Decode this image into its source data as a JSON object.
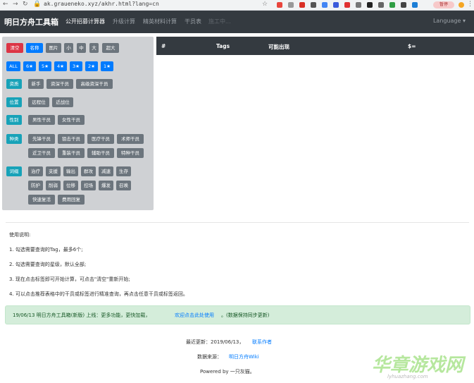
{
  "browser": {
    "url": "ak.graueneko.xyz/akhr.html?lang=cn",
    "profile_label": "暂停"
  },
  "navbar": {
    "brand": "明日方舟工具箱",
    "links": [
      "公开招募计算器",
      "升级计算",
      "精英材料计算",
      "干员表",
      "施工中..."
    ],
    "language": "Language ▾"
  },
  "filters": {
    "actions": [
      "清空",
      "名称",
      "图片",
      "小",
      "中",
      "大",
      "超大"
    ],
    "stars": [
      "ALL",
      "6★",
      "5★",
      "4★",
      "3★",
      "2★",
      "1★"
    ],
    "qualification": {
      "label": "资质",
      "tags": [
        "新手",
        "资深干员",
        "高级资深干员"
      ]
    },
    "position": {
      "label": "位置",
      "tags": [
        "远程位",
        "近战位"
      ]
    },
    "gender": {
      "label": "性别",
      "tags": [
        "男性干员",
        "女性干员"
      ]
    },
    "class": {
      "label": "种类",
      "tags": [
        "先锋干员",
        "狙击干员",
        "医疗干员",
        "术师干员",
        "近卫干员",
        "重装干员",
        "辅助干员",
        "特种干员"
      ]
    },
    "affix": {
      "label": "词缀",
      "tags": [
        "治疗",
        "支援",
        "输出",
        "群攻",
        "减速",
        "生存",
        "防护",
        "削弱",
        "位移",
        "控场",
        "爆发",
        "召唤",
        "快速复活",
        "费用回复"
      ]
    }
  },
  "table": {
    "headers": [
      "#",
      "Tags",
      "可能出现",
      "$="
    ]
  },
  "instructions": {
    "title": "使用说明:",
    "items": [
      "1. 勾选需要查询的Tag，最多6个;",
      "2. 勾选需要查询的星级，默认全部;",
      "3. 现在点击标签即可开始计算，可点击\"清空\"重新开始;",
      "4. 可以点击推荐表格中的干员或标签进行精准查询，再点击任意干员或标签返回。"
    ]
  },
  "alert": {
    "text": "19/06/13 明日方舟工具箱(新版) 上线：更多功能，更快加载，",
    "link": "欢迎点击此处使用",
    "suffix": "。(数据保持同步更新)"
  },
  "footer": {
    "updated_prefix": "最近更新：2019/06/13，",
    "contact": "联系作者",
    "source_prefix": "数据来源：",
    "source": "明日方舟Wiki",
    "powered": "Powered by 一只灰猫。"
  },
  "watermark": {
    "main": "华章游戏网",
    "sub": "lyhuazhang.com"
  }
}
